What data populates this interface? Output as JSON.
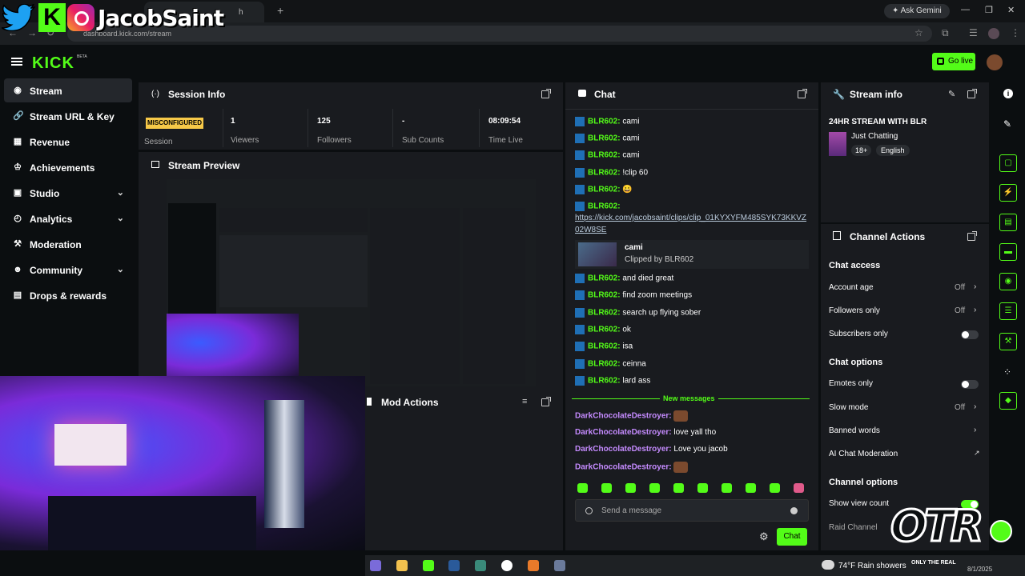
{
  "overlay": {
    "handle": "JacobSaint",
    "otr_logo": "OTR",
    "otr_tagline": "ONLY THE REAL"
  },
  "browser": {
    "tab_title": "h",
    "url": "dashboard.kick.com/stream",
    "gemini": "Ask Gemini"
  },
  "topbar": {
    "logo": "KICK",
    "beta": "BETA",
    "go_live": "Go live"
  },
  "sidebar": {
    "items": [
      {
        "label": "Stream",
        "icon": "broadcast-icon",
        "active": true
      },
      {
        "label": "Stream URL & Key",
        "icon": "link-icon"
      },
      {
        "label": "Revenue",
        "icon": "chart-icon"
      },
      {
        "label": "Achievements",
        "icon": "trophy-icon"
      },
      {
        "label": "Studio",
        "icon": "studio-icon",
        "chevron": true
      },
      {
        "label": "Analytics",
        "icon": "analytics-icon",
        "chevron": true
      },
      {
        "label": "Moderation",
        "icon": "hammer-icon"
      },
      {
        "label": "Community",
        "icon": "people-icon",
        "chevron": true
      },
      {
        "label": "Drops & rewards",
        "icon": "gift-icon"
      }
    ]
  },
  "session": {
    "title": "Session Info",
    "badge": "MISCONFIGURED",
    "session_label": "Session",
    "stats": [
      {
        "value": "1",
        "label": "Viewers"
      },
      {
        "value": "125",
        "label": "Followers"
      },
      {
        "value": "-",
        "label": "Sub Counts"
      },
      {
        "value": "08:09:54",
        "label": "Time Live"
      }
    ]
  },
  "preview": {
    "title": "Stream Preview"
  },
  "mod_actions": {
    "title": "Mod Actions"
  },
  "chat": {
    "title": "Chat",
    "messages": [
      {
        "user": "BLR602:",
        "text": "cami"
      },
      {
        "user": "BLR602:",
        "text": "cami"
      },
      {
        "user": "BLR602:",
        "text": "cami"
      },
      {
        "user": "BLR602:",
        "text": "!clip 60"
      },
      {
        "user": "BLR602:",
        "text": "😀"
      },
      {
        "user": "BLR602:",
        "text": ""
      }
    ],
    "link1": "https://kick.com/jacobsaint/clips/clip_01KYXYFM485SYK73KKVZ",
    "link2": "02W8SE",
    "clip": {
      "title": "cami",
      "by": "Clipped by BLR602"
    },
    "messages2": [
      {
        "user": "BLR602:",
        "text": "and died great"
      },
      {
        "user": "BLR602:",
        "text": "find zoom meetings"
      },
      {
        "user": "BLR602:",
        "text": "search up flying sober"
      },
      {
        "user": "BLR602:",
        "text": "ok"
      },
      {
        "user": "BLR602:",
        "text": "isa"
      },
      {
        "user": "BLR602:",
        "text": "ceinna"
      },
      {
        "user": "BLR602:",
        "text": "lard ass"
      }
    ],
    "new_messages": "New messages",
    "messages3": [
      {
        "user": "DarkChocolateDestroyer:",
        "text": ""
      },
      {
        "user": "DarkChocolateDestroyer:",
        "text": "love yall tho"
      },
      {
        "user": "DarkChocolateDestroyer:",
        "text": "Love you jacob"
      },
      {
        "user": "DarkChocolateDestroyer:",
        "text": ""
      }
    ],
    "placeholder": "Send a message",
    "send": "Chat"
  },
  "stream_info": {
    "title": "Stream info",
    "stream_title": "24HR STREAM WITH BLR",
    "category": "Just Chatting",
    "tags": [
      "18+",
      "English"
    ]
  },
  "channel_actions": {
    "title": "Channel Actions",
    "chat_access": "Chat access",
    "account_age": "Account age",
    "account_age_val": "Off",
    "followers_only": "Followers only",
    "followers_only_val": "Off",
    "subscribers_only": "Subscribers only",
    "chat_options": "Chat options",
    "emotes_only": "Emotes only",
    "slow_mode": "Slow mode",
    "slow_mode_val": "Off",
    "banned_words": "Banned words",
    "ai_mod": "AI Chat Moderation",
    "channel_options": "Channel options",
    "show_view_count": "Show view count",
    "raid_channel": "Raid Channel"
  },
  "taskbar": {
    "weather": "74°F",
    "weather_desc": "Rain showers",
    "date": "8/1/2025"
  },
  "colors": {
    "accent": "#53fc18",
    "panel": "#191b1f",
    "bg": "#0b0e10",
    "badge": "#f7c948",
    "purple_user": "#c58bff"
  }
}
